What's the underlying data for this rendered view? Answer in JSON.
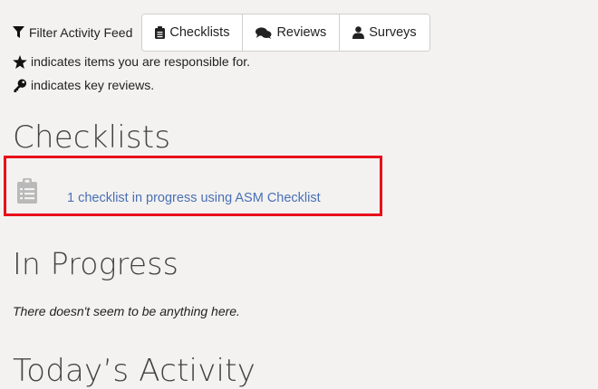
{
  "filter": {
    "label": "Filter Activity Feed",
    "buttons": [
      {
        "label": "Checklists",
        "icon": "clipboard-icon"
      },
      {
        "label": "Reviews",
        "icon": "comments-icon"
      },
      {
        "label": "Surveys",
        "icon": "user-icon"
      }
    ]
  },
  "legend": {
    "star_text": "indicates items you are responsible for.",
    "key_text": "indicates key reviews."
  },
  "sections": {
    "checklists": {
      "title": "Checklists",
      "link_text": "1 checklist in progress using ASM Checklist"
    },
    "in_progress": {
      "title": "In Progress",
      "empty_text": "There doesn't seem to be anything here."
    },
    "today": {
      "title": "Today’s Activity"
    }
  },
  "colors": {
    "background": "#f3f2f0",
    "link": "#4a6fb5",
    "highlight_border": "#e8101a"
  }
}
